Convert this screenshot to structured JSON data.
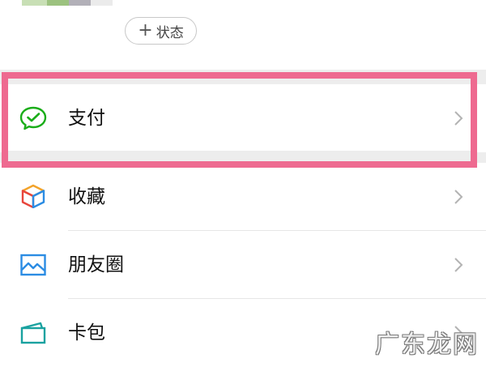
{
  "profile": {
    "status_plus": "+",
    "status_label": "状态"
  },
  "menu": {
    "items": [
      {
        "label": "支付",
        "icon": "pay-icon"
      },
      {
        "label": "收藏",
        "icon": "favorites-cube-icon"
      },
      {
        "label": "朋友圈",
        "icon": "moments-picture-icon"
      },
      {
        "label": "卡包",
        "icon": "card-wallet-icon"
      }
    ]
  },
  "watermark": "广东龙网",
  "colors": {
    "highlight": "#ee6a90",
    "pay_green": "#1aad19",
    "page_bg": "#ededed"
  }
}
